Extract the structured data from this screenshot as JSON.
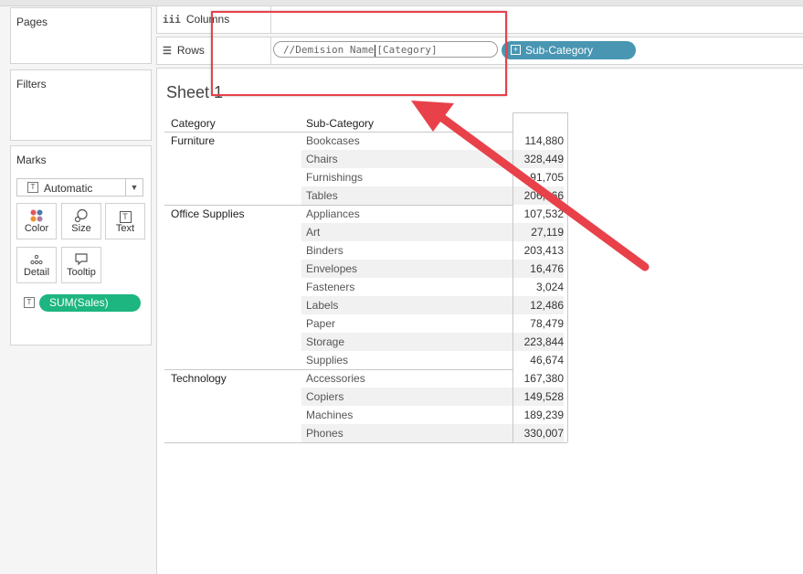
{
  "side": {
    "pages_title": "Pages",
    "filters_title": "Filters",
    "marks_title": "Marks",
    "mark_type": "Automatic",
    "mark_buttons": [
      "Color",
      "Size",
      "Text",
      "Detail",
      "Tooltip"
    ],
    "measure_pill": "SUM(Sales)"
  },
  "shelves": {
    "columns_label": "Columns",
    "rows_label": "Rows",
    "calc_text_before_caret": "//Demision Name",
    "calc_text_after_caret": "[Category]",
    "rows_pill": "Sub-Category"
  },
  "sheet": {
    "title": "Sheet 1",
    "headers": [
      "Category",
      "Sub-Category"
    ],
    "groups": [
      {
        "category": "Furniture",
        "rows": [
          {
            "sub": "Bookcases",
            "value": "114,880"
          },
          {
            "sub": "Chairs",
            "value": "328,449"
          },
          {
            "sub": "Furnishings",
            "value": "91,705"
          },
          {
            "sub": "Tables",
            "value": "206,966"
          }
        ]
      },
      {
        "category": "Office Supplies",
        "rows": [
          {
            "sub": "Appliances",
            "value": "107,532"
          },
          {
            "sub": "Art",
            "value": "27,119"
          },
          {
            "sub": "Binders",
            "value": "203,413"
          },
          {
            "sub": "Envelopes",
            "value": "16,476"
          },
          {
            "sub": "Fasteners",
            "value": "3,024"
          },
          {
            "sub": "Labels",
            "value": "12,486"
          },
          {
            "sub": "Paper",
            "value": "78,479"
          },
          {
            "sub": "Storage",
            "value": "223,844"
          },
          {
            "sub": "Supplies",
            "value": "46,674"
          }
        ]
      },
      {
        "category": "Technology",
        "rows": [
          {
            "sub": "Accessories",
            "value": "167,380"
          },
          {
            "sub": "Copiers",
            "value": "149,528"
          },
          {
            "sub": "Machines",
            "value": "189,239"
          },
          {
            "sub": "Phones",
            "value": "330,007"
          }
        ]
      }
    ]
  },
  "colors": {
    "annotation_red": "#e8414a",
    "dimension_pill": "#4996b2",
    "measure_pill": "#1db580"
  }
}
